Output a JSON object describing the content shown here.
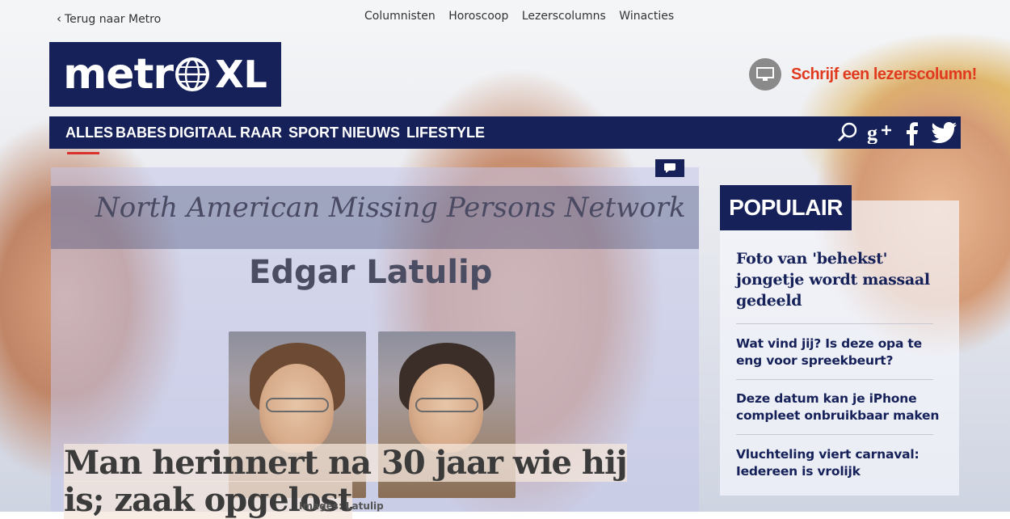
{
  "topbar": {
    "back_label": "Terug naar Metro",
    "links": [
      "Columnisten",
      "Horoscoop",
      "Lezerscolumns",
      "Winacties"
    ]
  },
  "logo": {
    "part1": "metr",
    "part2": "XL"
  },
  "header": {
    "write_column_label": "Schrijf een lezerscolumn!"
  },
  "nav": {
    "items": [
      "ALLES",
      "BABES",
      "DIGITAAL",
      "RAAR",
      "SPORT",
      "NIEUWS",
      "LIFESTYLE"
    ],
    "active": "ALLES",
    "icons": [
      "search-icon",
      "google-plus-icon",
      "facebook-icon",
      "twitter-icon"
    ]
  },
  "article": {
    "image_banner": "North American Missing Persons Network",
    "image_name": "Edgar Latulip",
    "headline": "Man herinnert na 30 jaar wie hij is; zaak opgelost",
    "caption": "Images: Latulip"
  },
  "popular": {
    "title": "POPULAIR",
    "items": [
      "Foto van 'behekst' jongetje wordt massaal gedeeld",
      "Wat vind jij? Is deze opa te eng voor spreekbeurt?",
      "Deze datum kan je iPhone compleet onbruikbaar maken",
      "Vluchteling viert carnaval: Iedereen is vrolijk"
    ]
  },
  "colors": {
    "navy": "#152158",
    "accent_red": "#e03b1f",
    "active_underline": "#d9322d"
  }
}
